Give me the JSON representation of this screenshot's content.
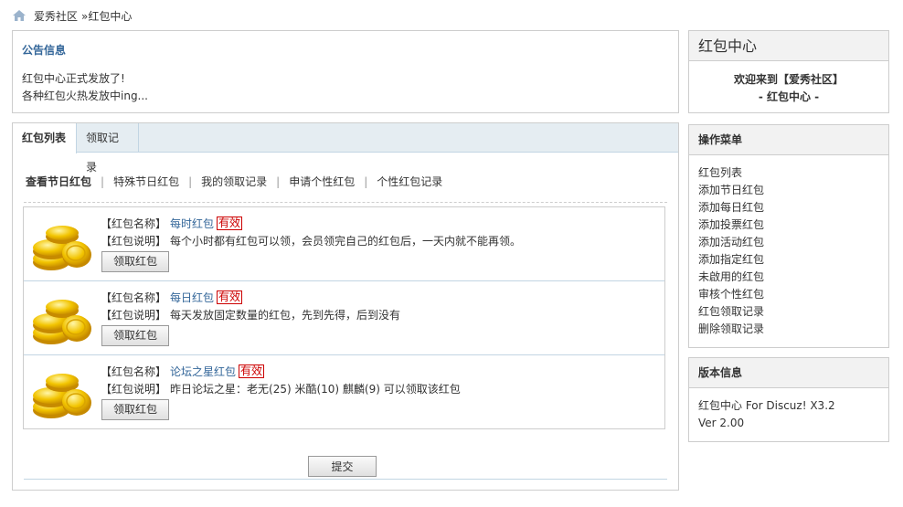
{
  "breadcrumb": {
    "home_icon": "home-icon",
    "site": "爱秀社区",
    "current": "»红包中心"
  },
  "notice": {
    "title": "公告信息",
    "lines": [
      "红包中心正式发放了!",
      "各种红包火热发放中ing..."
    ]
  },
  "tabs": [
    {
      "label": "红包列表",
      "active": true
    },
    {
      "label": "领取记录",
      "active": false
    }
  ],
  "subnav": [
    "查看节日红包",
    "特殊节日红包",
    "我的领取记录",
    "申请个性红包",
    "个性红包记录"
  ],
  "packets": [
    {
      "name_label": "【红包名称】",
      "name": "每时红包",
      "status": "有效",
      "desc_label": "【红包说明】",
      "desc": "每个小时都有红包可以领，会员领完自己的红包后，一天内就不能再领。",
      "button": "领取红包"
    },
    {
      "name_label": "【红包名称】",
      "name": "每日红包",
      "status": "有效",
      "desc_label": "【红包说明】",
      "desc": "每天发放固定数量的红包，先到先得，后到没有",
      "button": "领取红包"
    },
    {
      "name_label": "【红包名称】",
      "name": "论坛之星红包",
      "status": "有效",
      "desc_label": "【红包说明】",
      "desc": "昨日论坛之星：老无(25) 米酷(10) 麒麟(9) 可以领取该红包",
      "button": "领取红包"
    }
  ],
  "submit_label": "提交",
  "sidebar": {
    "center": {
      "title": "红包中心",
      "welcome_1": "欢迎来到【爱秀社区】",
      "welcome_2": "- 红包中心 -"
    },
    "menu": {
      "title": "操作菜单",
      "items": [
        "红包列表",
        "添加节日红包",
        "添加每日红包",
        "添加投票红包",
        "添加活动红包",
        "添加指定红包",
        "未啟用的红包",
        "审核个性红包",
        "红包领取记录",
        "删除领取记录"
      ]
    },
    "version": {
      "title": "版本信息",
      "line_1": "红包中心 For Discuz! X3.2",
      "line_2": "Ver 2.00"
    }
  },
  "colors": {
    "link": "#336699",
    "badge": "#cc0000",
    "tabbar": "#e5edf2",
    "side_head": "#f2f2f2"
  }
}
